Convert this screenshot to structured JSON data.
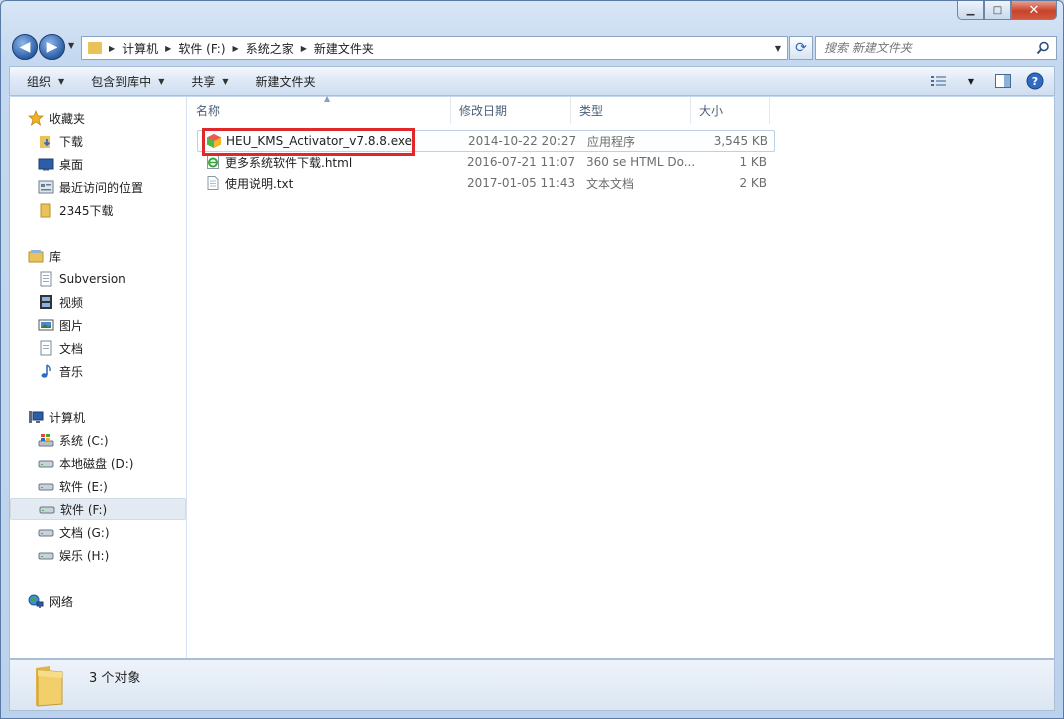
{
  "window": {
    "caption": {
      "minimize": "▁",
      "maximize": "□",
      "close": "✕"
    }
  },
  "address_bar": {
    "breadcrumbs": [
      "计算机",
      "软件 (F:)",
      "系统之家",
      "新建文件夹"
    ]
  },
  "search": {
    "placeholder": "搜索 新建文件夹"
  },
  "toolbar": {
    "organize": "组织",
    "include_in_library": "包含到库中",
    "share": "共享",
    "new_folder": "新建文件夹"
  },
  "nav_pane": {
    "favorites": {
      "label": "收藏夹",
      "items": [
        "下载",
        "桌面",
        "最近访问的位置",
        "2345下载"
      ]
    },
    "libraries": {
      "label": "库",
      "items": [
        "Subversion",
        "视频",
        "图片",
        "文档",
        "音乐"
      ]
    },
    "computer": {
      "label": "计算机",
      "items": [
        "系统 (C:)",
        "本地磁盘 (D:)",
        "软件 (E:)",
        "软件 (F:)",
        "文档 (G:)",
        "娱乐 (H:)"
      ],
      "selected": "软件 (F:)"
    },
    "network": {
      "label": "网络"
    }
  },
  "file_list": {
    "columns": [
      "名称",
      "修改日期",
      "类型",
      "大小"
    ],
    "rows": [
      {
        "name": "HEU_KMS_Activator_v7.8.8.exe",
        "modified": "2014-10-22 20:27",
        "type": "应用程序",
        "size": "3,545 KB",
        "icon": "exe-icon"
      },
      {
        "name": "更多系统软件下载.html",
        "modified": "2016-07-21 11:07",
        "type": "360 se HTML Do...",
        "size": "1 KB",
        "icon": "html-icon"
      },
      {
        "name": "使用说明.txt",
        "modified": "2017-01-05 11:43",
        "type": "文本文档",
        "size": "2 KB",
        "icon": "txt-icon"
      }
    ]
  },
  "status_bar": {
    "text": "3 个对象"
  },
  "colors": {
    "highlight": "#e0272a",
    "window_frame": "#bcd2ec",
    "folder": "#e9c35a"
  }
}
